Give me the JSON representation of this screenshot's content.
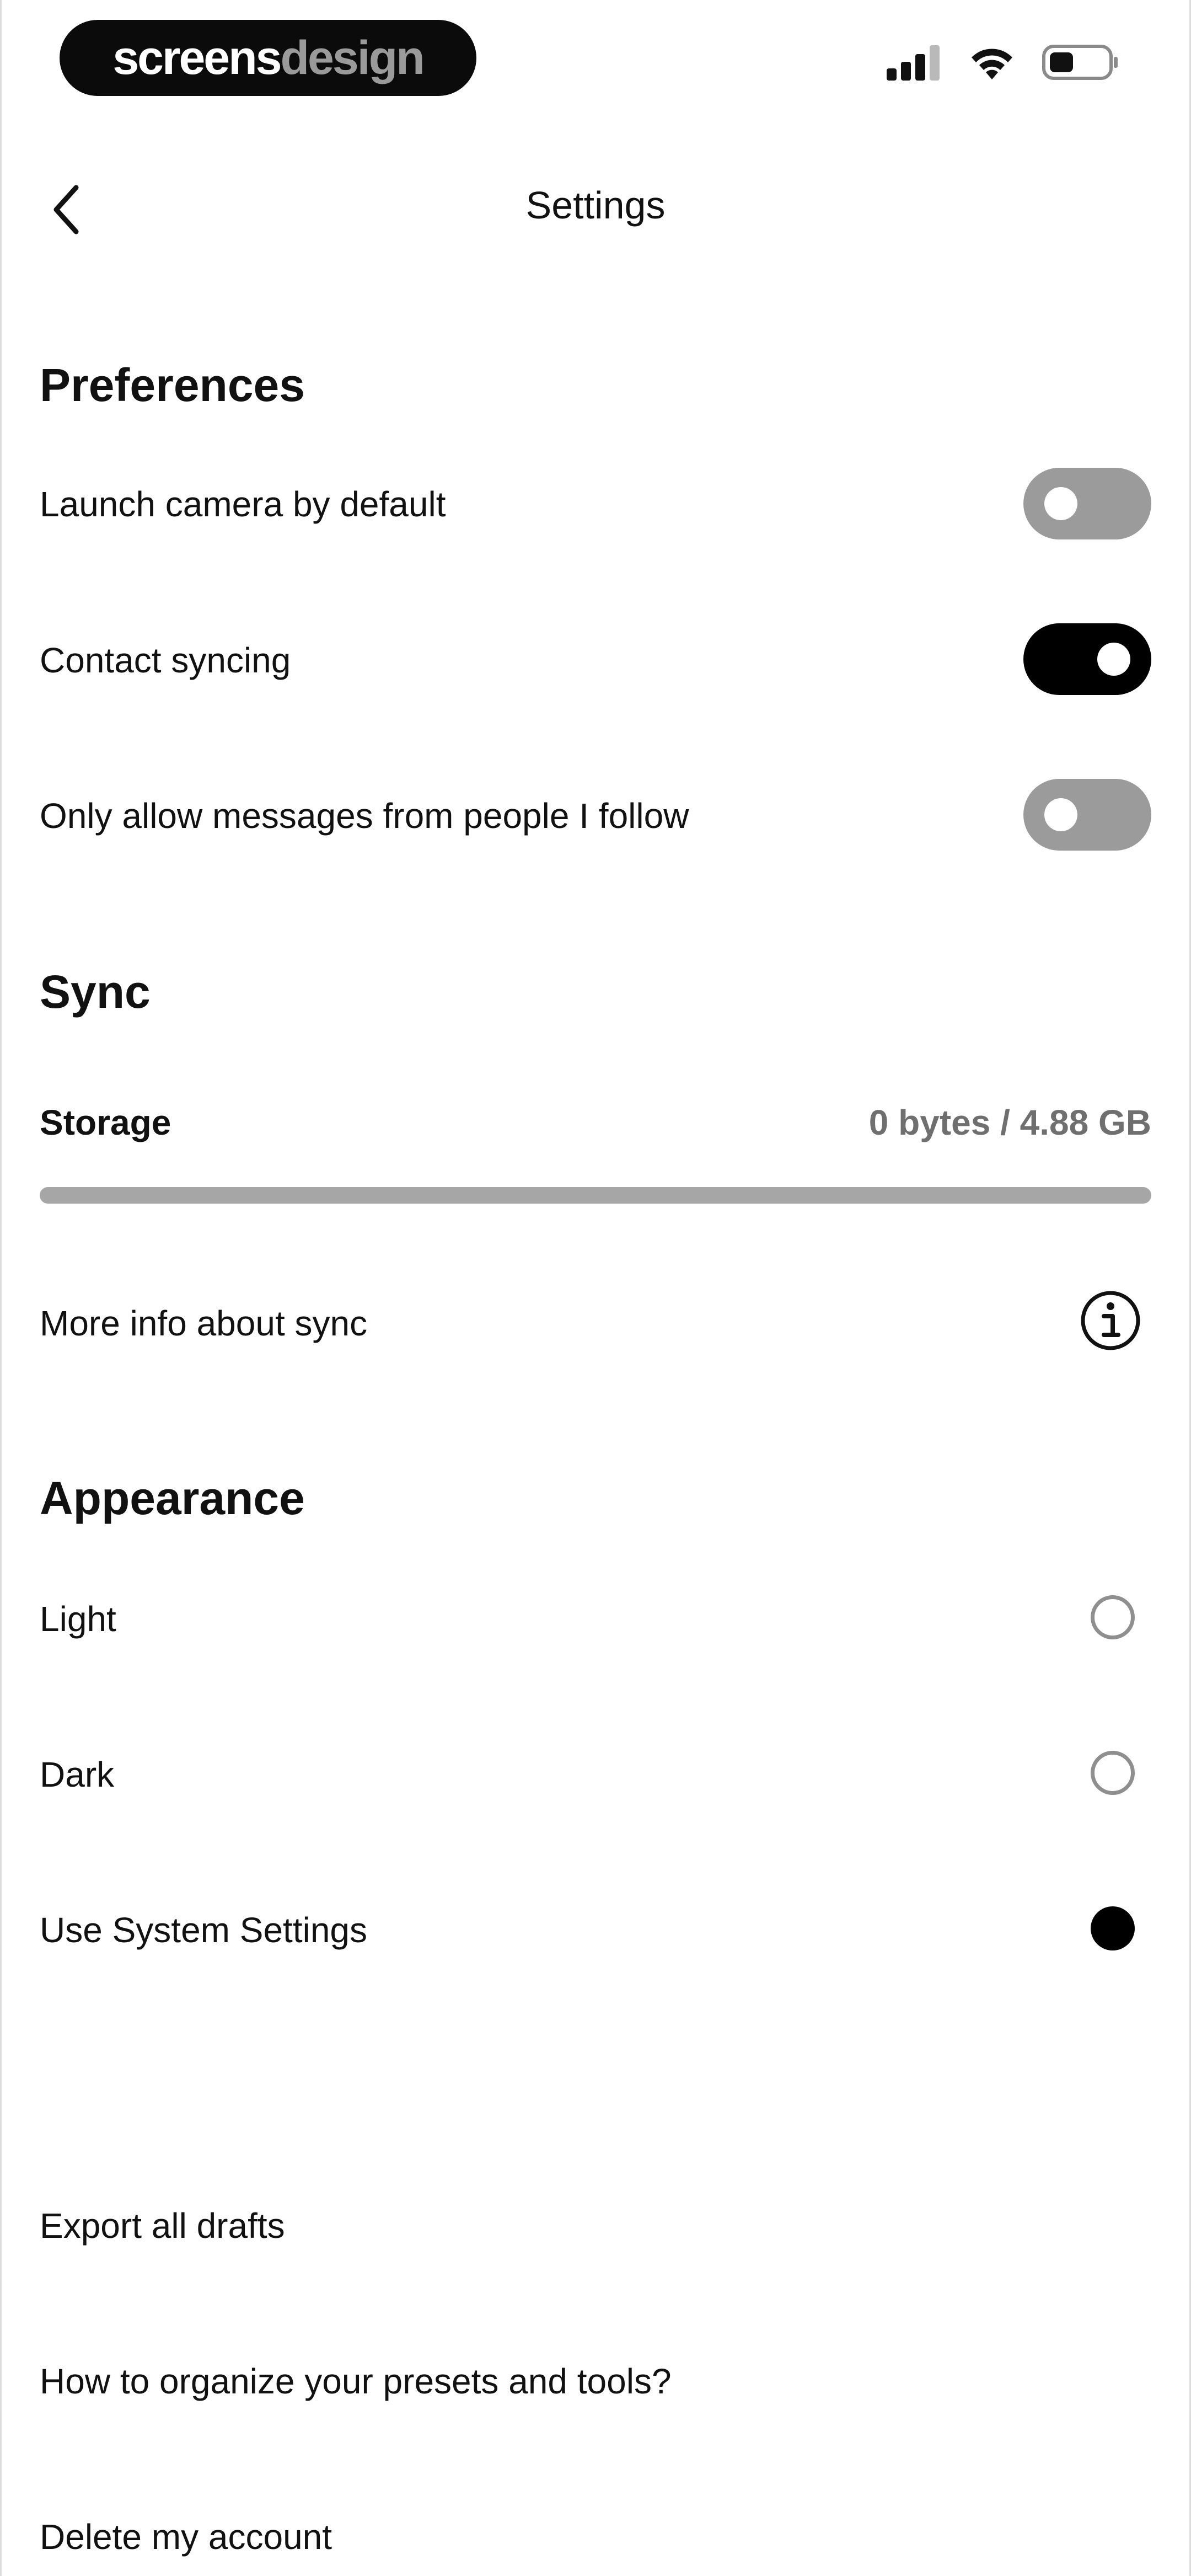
{
  "status_bar": {
    "brand_primary": "screens",
    "brand_secondary": "design",
    "signal_icon": "cellular-signal-icon",
    "wifi_icon": "wifi-icon",
    "battery_icon": "battery-icon"
  },
  "header": {
    "title": "Settings",
    "back_icon": "chevron-left-icon"
  },
  "preferences": {
    "title": "Preferences",
    "items": [
      {
        "label": "Launch camera by default",
        "enabled": false
      },
      {
        "label": "Contact syncing",
        "enabled": true
      },
      {
        "label": "Only allow messages from people I follow",
        "enabled": false
      }
    ]
  },
  "sync": {
    "title": "Sync",
    "storage_label": "Storage",
    "storage_value": "0 bytes / 4.88 GB",
    "storage_used_fraction": 0,
    "more_info_label": "More info about sync",
    "info_icon": "info-circle-icon"
  },
  "appearance": {
    "title": "Appearance",
    "options": [
      {
        "label": "Light",
        "selected": false
      },
      {
        "label": "Dark",
        "selected": false
      },
      {
        "label": "Use System Settings",
        "selected": true
      }
    ]
  },
  "actions": {
    "export_drafts": "Export all drafts",
    "organize_presets": "How to organize your presets and tools?",
    "delete_account": "Delete my account"
  },
  "colors": {
    "toggle_on": "#000000",
    "toggle_off": "#9b9b9b",
    "progress_track": "#a6a6a6"
  }
}
